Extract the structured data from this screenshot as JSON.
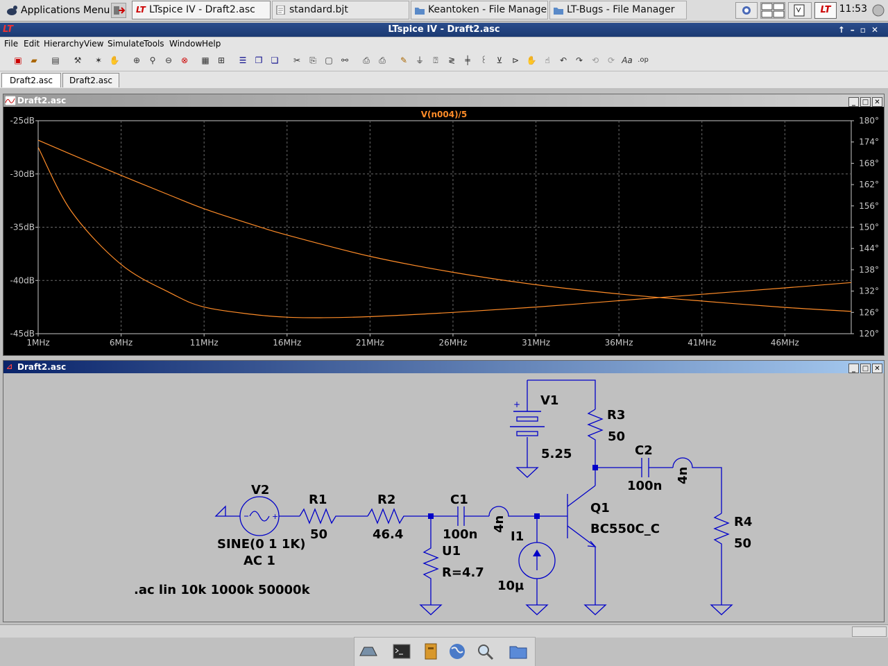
{
  "taskbar": {
    "app_menu": "Applications Menu",
    "tasks": [
      {
        "label": "LTspice IV - Draft2.asc"
      },
      {
        "label": "standard.bjt"
      },
      {
        "label": "Keantoken - File Manager"
      },
      {
        "label": "LT-Bugs - File Manager"
      }
    ],
    "clock": "11:53"
  },
  "window": {
    "title": "LTspice IV - Draft2.asc"
  },
  "menu": [
    "File",
    "Edit",
    "Hierarchy",
    "View",
    "Simulate",
    "Tools",
    "Window",
    "Help"
  ],
  "doc_tabs": [
    "Draft2.asc",
    "Draft2.asc"
  ],
  "plot_window": {
    "title": "Draft2.asc"
  },
  "schematic_window": {
    "title": "Draft2.asc"
  },
  "chart_data": {
    "type": "line",
    "title": "V(n004)/5",
    "xlabel": "",
    "ylabel": "",
    "x_unit": "MHz",
    "xlim": [
      1,
      50
    ],
    "ylim": [
      -45,
      -25
    ],
    "y2lim": [
      120,
      180
    ],
    "x_ticks": [
      "1MHz",
      "6MHz",
      "11MHz",
      "16MHz",
      "21MHz",
      "26MHz",
      "31MHz",
      "36MHz",
      "41MHz",
      "46MHz"
    ],
    "y_ticks": [
      "-25dB",
      "-30dB",
      "-35dB",
      "-40dB",
      "-45dB"
    ],
    "y2_ticks": [
      "180°",
      "174°",
      "168°",
      "162°",
      "156°",
      "150°",
      "144°",
      "138°",
      "132°",
      "126°",
      "120°"
    ],
    "grid": true,
    "colors": {
      "trace": "#ff8c28",
      "grid": "#6a6a6a",
      "axis": "#c8c8c8"
    },
    "series": [
      {
        "axis": "left",
        "x": [
          1,
          3,
          6,
          9,
          11,
          14,
          16,
          18,
          21,
          26,
          31,
          36,
          41,
          46,
          50
        ],
        "y": [
          -27.5,
          -33.5,
          -38.5,
          -41.2,
          -42.5,
          -43.2,
          -43.45,
          -43.5,
          -43.4,
          -43.0,
          -42.5,
          -41.9,
          -41.3,
          -40.7,
          -40.2
        ]
      },
      {
        "axis": "right",
        "x": [
          1,
          3,
          6,
          9,
          11,
          14,
          16,
          21,
          26,
          31,
          36,
          41,
          46,
          50
        ],
        "y": [
          174.5,
          170.5,
          164.6,
          158.9,
          155.2,
          150.6,
          147.8,
          141.8,
          137.3,
          133.8,
          131.2,
          129.2,
          127.4,
          126.3
        ]
      }
    ]
  },
  "schematic": {
    "components": {
      "V1": {
        "name": "V1",
        "value": "5.25"
      },
      "R3": {
        "name": "R3",
        "value": "50"
      },
      "C2": {
        "name": "C2",
        "value": "100n"
      },
      "L2": {
        "value": "4n"
      },
      "V2": {
        "name": "V2",
        "value": "SINE(0 1 1K)",
        "ac": "AC 1"
      },
      "R1": {
        "name": "R1",
        "value": "50"
      },
      "R2": {
        "name": "R2",
        "value": "46.4"
      },
      "C1": {
        "name": "C1",
        "value": "100n"
      },
      "L1": {
        "value": "4n"
      },
      "Q1": {
        "name": "Q1",
        "value": "BC550C_C"
      },
      "I1": {
        "name": "I1",
        "value": "10µ"
      },
      "U1": {
        "name": "U1",
        "value": "R=4.7"
      },
      "R4": {
        "name": "R4",
        "value": "50"
      }
    },
    "directive": ".ac lin 10k 1000k 50000k"
  }
}
